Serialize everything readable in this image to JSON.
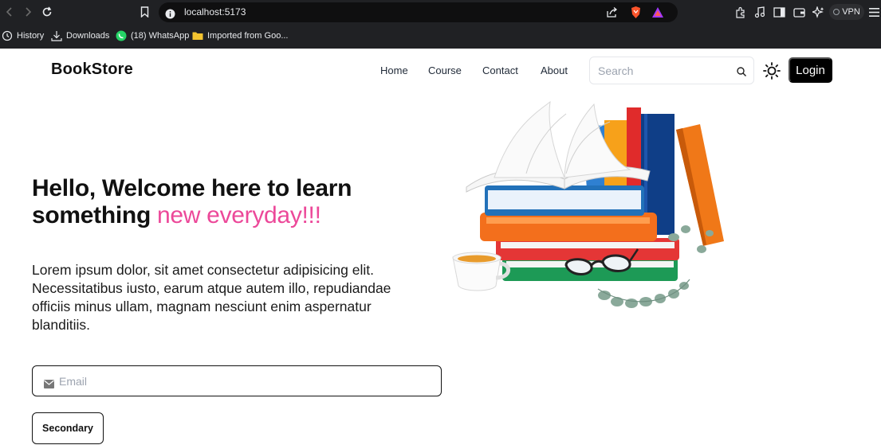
{
  "browser": {
    "url": "localhost:5173",
    "vpn_label": "VPN",
    "bookmarks": [
      {
        "label": "History"
      },
      {
        "label": "Downloads"
      },
      {
        "label": "(18) WhatsApp"
      },
      {
        "label": "Imported from Goo..."
      }
    ]
  },
  "navbar": {
    "brand": "BookStore",
    "links": [
      "Home",
      "Course",
      "Contact",
      "About"
    ],
    "search_placeholder": "Search",
    "login_label": "Login"
  },
  "hero": {
    "title_line1": "Hello, Welcome here to learn",
    "title_line2_plain": "something ",
    "title_line2_accent": "new everyday!!!",
    "paragraph": "Lorem ipsum dolor, sit amet consectetur adipisicing elit. Necessitatibus iusto, earum atque autem illo, repudiandae officiis minus ullam, magnam nesciunt enim aspernatur blanditiis.",
    "email_placeholder": "Email",
    "secondary_label": "Secondary"
  },
  "colors": {
    "accent": "#ec4899",
    "login_bg": "#000000",
    "chrome_bg": "#202124"
  }
}
